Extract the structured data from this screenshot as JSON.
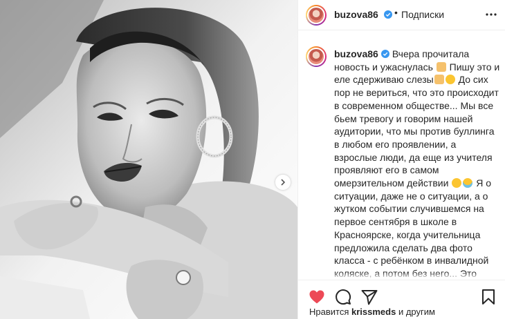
{
  "header": {
    "username": "buzova86",
    "separator": "•",
    "follow_label": "Подписки",
    "verified_icon": "verified-badge-icon",
    "more_icon": "more-options-icon"
  },
  "post": {
    "username": "buzova86",
    "caption_parts": [
      "Вчера прочитала новость и ужаснулась",
      "Пишу это и еле сдерживаю слезы",
      "До сих пор не вериться, что это происходит в современном обществе... Мы все бьем тревогу и говорим нашей аудитории, что мы против буллинга в любом его проявлении, а взрослые люди, да еще из учителя проявляют его в самом омерзительном действии",
      "Я о ситуации, даже не о ситуации, а о жутком событии случившемся на первое сентября в школе в Красноярске, когда учительница предложила сделать два фото класса - с ребёнком в инвалидной коляске, а потом без него... Это зачем? Почему родители которые присутствовали во время"
    ],
    "emojis": [
      "praying-hands-emoji",
      "praying-hands-emoji",
      "sad-face-emoji",
      "crying-face-emoji",
      "crying-face-emoji"
    ]
  },
  "actions": {
    "like_icon": "heart-icon",
    "comment_icon": "comment-icon",
    "share_icon": "share-icon",
    "save_icon": "bookmark-icon",
    "like_color": "#ed4956"
  },
  "likes": {
    "prefix": "Нравится",
    "user": "krissmeds",
    "suffix": "и другим"
  },
  "photo": {
    "carousel_icon": "chevron-right-icon"
  }
}
